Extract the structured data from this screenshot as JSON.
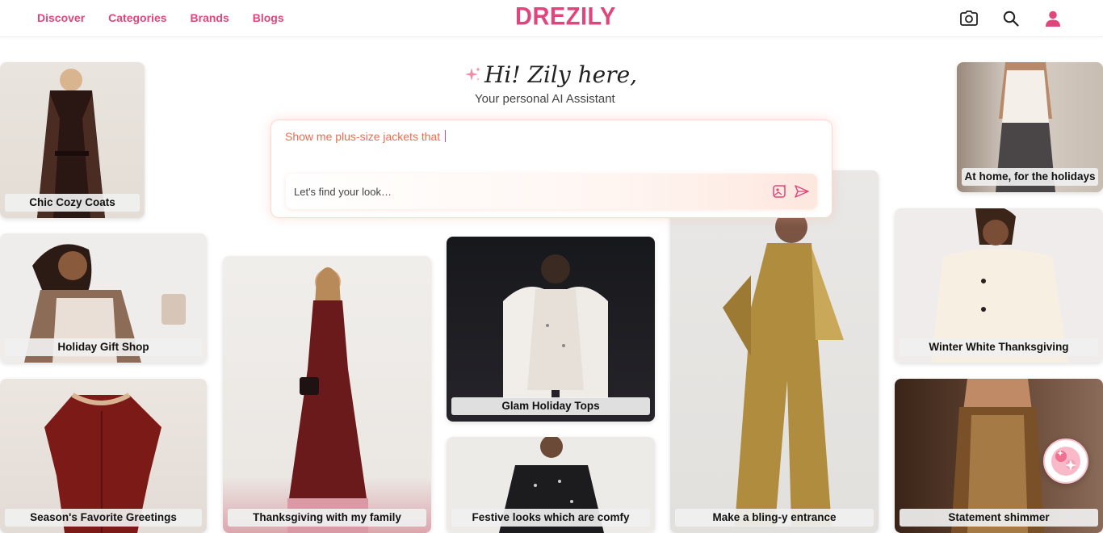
{
  "nav": {
    "links": [
      "Discover",
      "Categories",
      "Brands",
      "Blogs"
    ],
    "logo": "DREZILY",
    "icons": [
      "camera-icon",
      "search-icon",
      "user-icon"
    ]
  },
  "hero": {
    "title": "Hi! Zily here,",
    "subtitle": "Your personal AI Assistant",
    "typed_prompt": "Show me plus-size jackets that ",
    "input_placeholder": "Let's find your look…"
  },
  "cards": [
    {
      "label": "Chic Cozy Coats"
    },
    {
      "label": "Holiday Gift Shop"
    },
    {
      "label": "Season's Favorite Greetings"
    },
    {
      "label": "Thanksgiving with my family"
    },
    {
      "label": "Glam Holiday Tops"
    },
    {
      "label": "Festive looks which are comfy"
    },
    {
      "label": "Make a bling-y entrance"
    },
    {
      "label": "At home, for the holidays"
    },
    {
      "label": "Winter White Thanksgiving"
    },
    {
      "label": "Statement shimmer"
    }
  ],
  "colors": {
    "brand": "#e0467c",
    "typed_text": "#ef6a4f"
  }
}
